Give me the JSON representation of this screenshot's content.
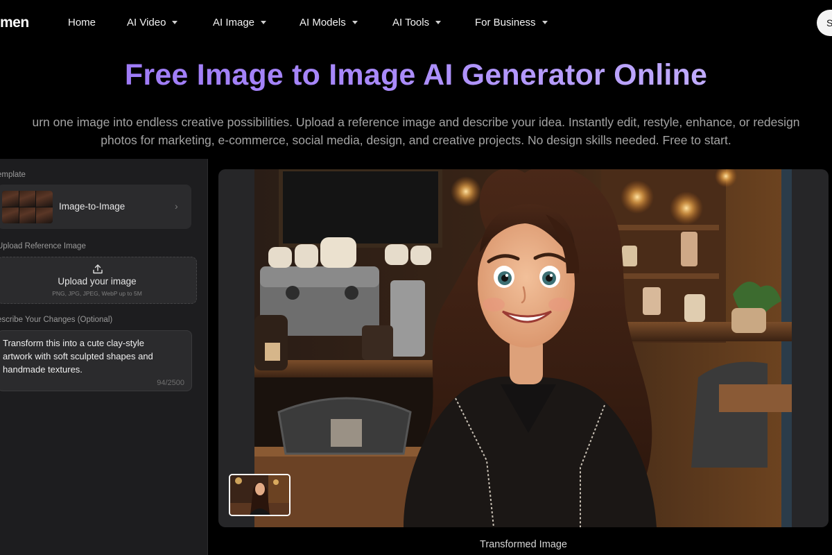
{
  "nav": {
    "logo": "men",
    "items": [
      {
        "label": "Home",
        "has_dropdown": false
      },
      {
        "label": "AI Video",
        "has_dropdown": true
      },
      {
        "label": "AI Image",
        "has_dropdown": true
      },
      {
        "label": "AI Models",
        "has_dropdown": true
      },
      {
        "label": "AI Tools",
        "has_dropdown": true
      },
      {
        "label": "For Business",
        "has_dropdown": true
      }
    ],
    "cta_label": "S"
  },
  "hero": {
    "title": "Free Image to Image AI Generator Online",
    "desc_line1": "urn one image into endless creative possibilities. Upload a reference image and describe your idea. Instantly edit, restyle, enhance, or redesign",
    "desc_line2": "photos for marketing, e-commerce, social media, design, and creative projects. No design skills needed. Free to start."
  },
  "left_panel": {
    "template_label": "emplate",
    "template_name": "Image-to-Image",
    "upload_label": "Upload Reference Image",
    "upload_title": "Upload your image",
    "upload_hint": "PNG, JPG, JPEG, WebP up to 5M",
    "prompt_label": "escribe Your Changes (Optional)",
    "prompt_text": "Transform this into a cute clay-style artwork with soft sculpted shapes and handmade textures.",
    "prompt_count": "94/2500"
  },
  "preview": {
    "caption": "Transformed Image"
  },
  "colors": {
    "background": "#000000",
    "title_gradient_start": "#9a74f5",
    "title_gradient_end": "#c9b8ff",
    "panel": "#1d1d1f",
    "card": "#2b2b2d"
  },
  "icons": {
    "dropdown": "caret-down-icon",
    "template_chevron": "chevron-right-icon",
    "upload": "upload-icon"
  }
}
